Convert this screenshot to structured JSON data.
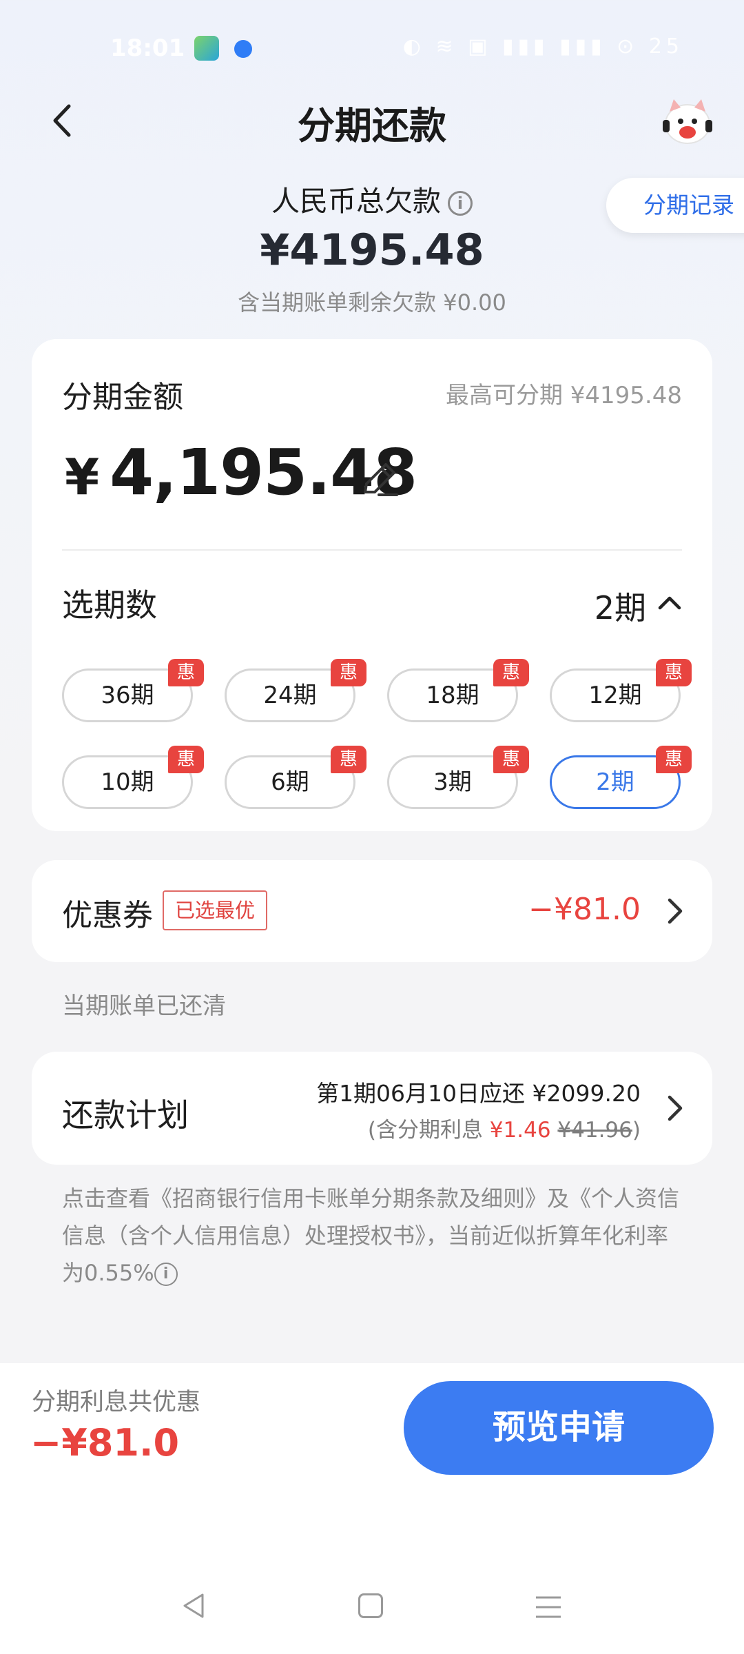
{
  "status_bar": {
    "time": "18:01",
    "icons": "◐ ≋ ▣ ▮▮▮ ▮▮▮ ⊙ 25"
  },
  "header": {
    "title": "分期还款",
    "record_button": "分期记录"
  },
  "summary": {
    "label": "人民币总欠款",
    "amount": "¥4195.48",
    "sub": "含当期账单剩余欠款 ¥0.00"
  },
  "installment": {
    "amount_label": "分期金额",
    "max_label": "最高可分期 ¥4195.48",
    "currency": "¥",
    "amount": "4,195.48",
    "period_label": "选期数",
    "selected_period": "2期",
    "badge": "惠",
    "options": [
      {
        "label": "36期",
        "selected": false
      },
      {
        "label": "24期",
        "selected": false
      },
      {
        "label": "18期",
        "selected": false
      },
      {
        "label": "12期",
        "selected": false
      },
      {
        "label": "10期",
        "selected": false
      },
      {
        "label": "6期",
        "selected": false
      },
      {
        "label": "3期",
        "selected": false
      },
      {
        "label": "2期",
        "selected": true
      }
    ]
  },
  "coupon": {
    "label": "优惠券",
    "tag": "已选最优",
    "value": "−¥81.0"
  },
  "bill_status": "当期账单已还清",
  "plan": {
    "label": "还款计划",
    "main": "第1期06月10日应还 ¥2099.20",
    "sub_prefix": "(含分期利息 ",
    "interest": "¥1.46",
    "original_interest": "¥41.96",
    "sub_suffix": ")"
  },
  "terms": "点击查看《招商银行信用卡账单分期条款及细则》及《个人资信信息（含个人信用信息）处理授权书》，当前近似折算年化利率为0.55%",
  "footer": {
    "discount_label": "分期利息共优惠",
    "discount_value": "−¥81.0",
    "apply_button": "预览申请"
  },
  "colors": {
    "accent": "#3c7cf2",
    "discount": "#e8443f"
  }
}
